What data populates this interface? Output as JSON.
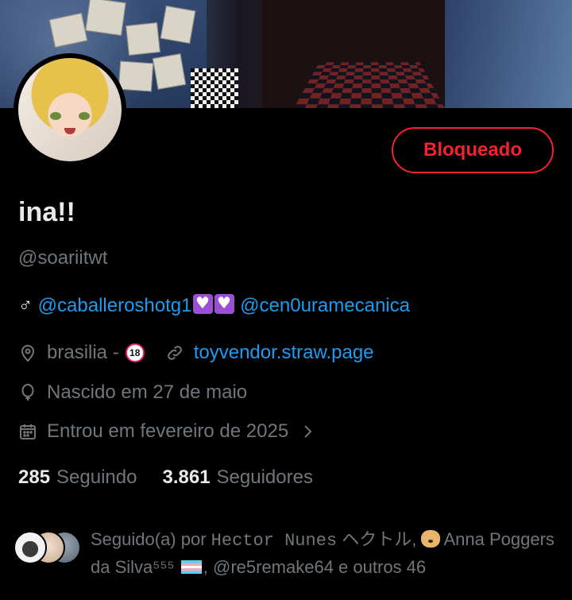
{
  "profile": {
    "name": "ina!!",
    "handle": "@soariitwt",
    "blocked_label": "Bloqueado",
    "bio": {
      "gender_symbol": "♂",
      "mention1": "@caballeroshotg1",
      "mention2": "@cen0uramecanica"
    },
    "location": "brasilia -",
    "age_badge": "18",
    "website": "toyvendor.straw.page",
    "birthday": "Nascido em 27 de maio",
    "joined": "Entrou em fevereiro de 2025"
  },
  "stats": {
    "following_count": "285",
    "following_label": "Seguindo",
    "followers_count": "3.861",
    "followers_label": "Seguidores"
  },
  "followed_by": {
    "prefix": "Seguido(a) por",
    "user1": "Hector Nunes",
    "user1_suffix": "ヘクトル,",
    "user2": "Anna Poggers da Silva⁵⁵⁵",
    "user3": ", @re5remake64 e outros 46"
  },
  "colors": {
    "accent": "#1d9bf0",
    "blocked": "#f4212e",
    "muted": "#71767b",
    "text": "#e7e9ea"
  },
  "icons": [
    "location-pin-icon",
    "link-icon",
    "balloon-icon",
    "calendar-icon",
    "chevron-right-icon"
  ]
}
